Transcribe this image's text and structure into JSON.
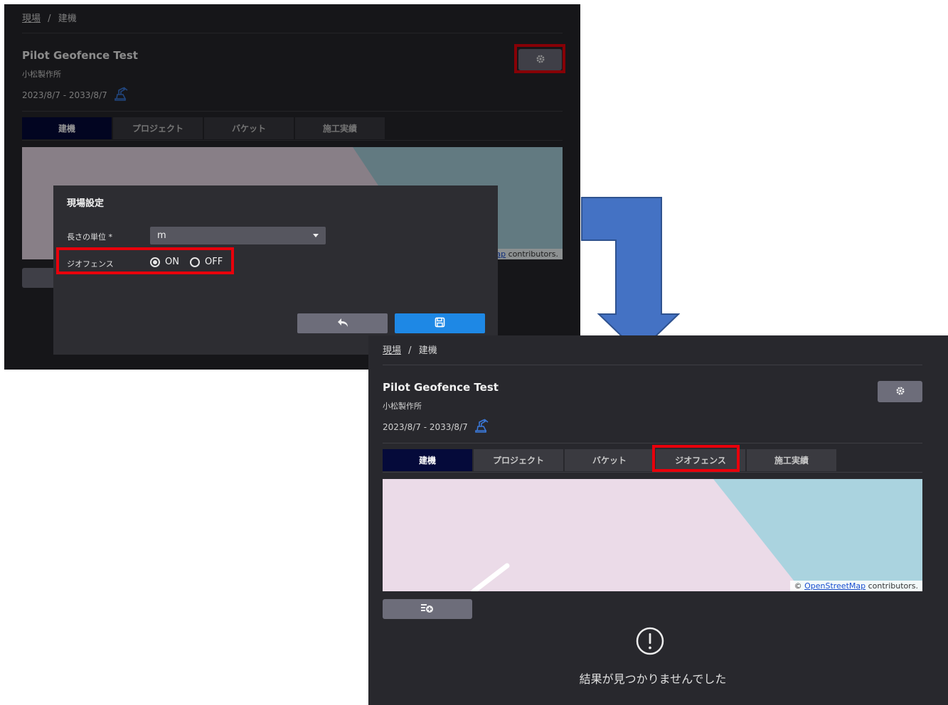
{
  "before": {
    "breadcrumb": {
      "link": "現場",
      "sep": "/",
      "current": "建機"
    },
    "site": {
      "title": "Pilot Geofence Test",
      "company": "小松製作所",
      "dates": "2023/8/7 - 2033/8/7"
    },
    "tabs": [
      {
        "label": "建機",
        "active": true
      },
      {
        "label": "プロジェクト",
        "active": false
      },
      {
        "label": "バケット",
        "active": false
      },
      {
        "label": "施工実績",
        "active": false
      }
    ],
    "map_attribution": {
      "link": "ap",
      "text": " contributors."
    },
    "modal": {
      "title": "現場設定",
      "unit_label": "長さの単位 *",
      "unit_value": "m",
      "geofence_label": "ジオフェンス",
      "option_on": "ON",
      "option_off": "OFF",
      "selected": "ON"
    }
  },
  "after": {
    "breadcrumb": {
      "link": "現場",
      "sep": "/",
      "current": "建機"
    },
    "site": {
      "title": "Pilot Geofence Test",
      "company": "小松製作所",
      "dates": "2023/8/7 - 2033/8/7"
    },
    "tabs": [
      {
        "label": "建機",
        "active": true
      },
      {
        "label": "プロジェクト",
        "active": false
      },
      {
        "label": "バケット",
        "active": false
      },
      {
        "label": "ジオフェンス",
        "active": false
      },
      {
        "label": "施工実績",
        "active": false
      }
    ],
    "map_attribution": {
      "prefix": "© ",
      "link": "OpenStreetMap",
      "text": " contributors."
    },
    "empty_message": "結果が見つかりませんでした"
  },
  "colors": {
    "highlight": "#e8000b",
    "arrow": "#4472c4",
    "active_tab": "#050a3a",
    "save_button": "#1e88e5",
    "map_land": "#ebdbe8",
    "map_water": "#aad3df"
  },
  "icons": [
    "gear-icon",
    "excavator-icon",
    "undo-icon",
    "save-icon",
    "add-list-icon",
    "alert-circle-icon",
    "down-arrow"
  ]
}
